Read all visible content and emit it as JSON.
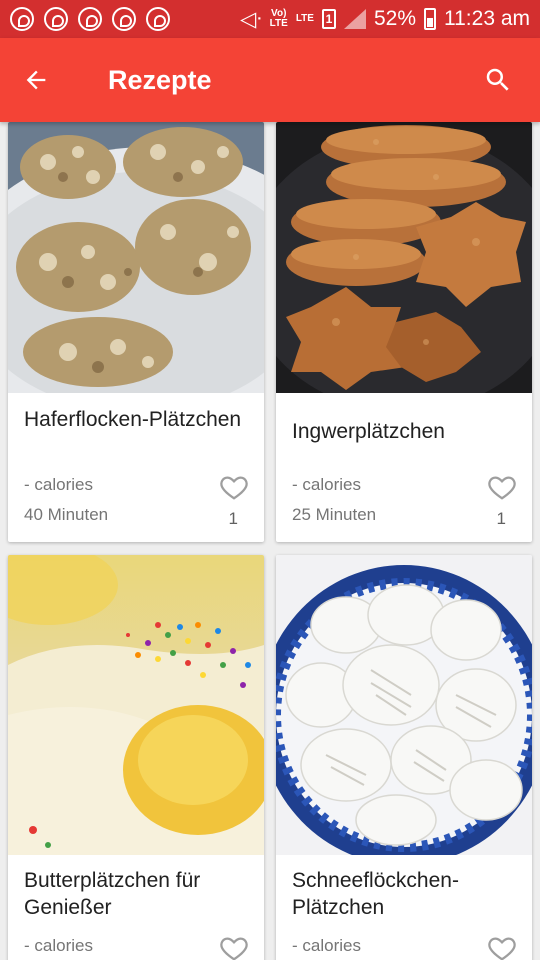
{
  "status_bar": {
    "network_tag_top": "Vo)",
    "network_tag_bottom": "LTE",
    "lte_tag": "LTE",
    "sim": "1",
    "battery": "52%",
    "time": "11:23 am"
  },
  "app_bar": {
    "title": "Rezepte",
    "back_icon": "arrow-back-icon",
    "search_icon": "search-icon"
  },
  "recipes": [
    {
      "name": "Haferflocken-Plätzchen",
      "calories": "- calories",
      "time": "40 Minuten",
      "likes": "1"
    },
    {
      "name": "Ingwerplätzchen",
      "calories": "- calories",
      "time": "25 Minuten",
      "likes": "1"
    },
    {
      "name": "Butterplätzchen für Genießer",
      "calories": "- calories"
    },
    {
      "name": "Schneeflöckchen-Plätzchen",
      "calories": "- calories"
    }
  ],
  "colors": {
    "status_bar": "#d32f2f",
    "app_bar": "#f44336",
    "background": "#eeeeee"
  }
}
